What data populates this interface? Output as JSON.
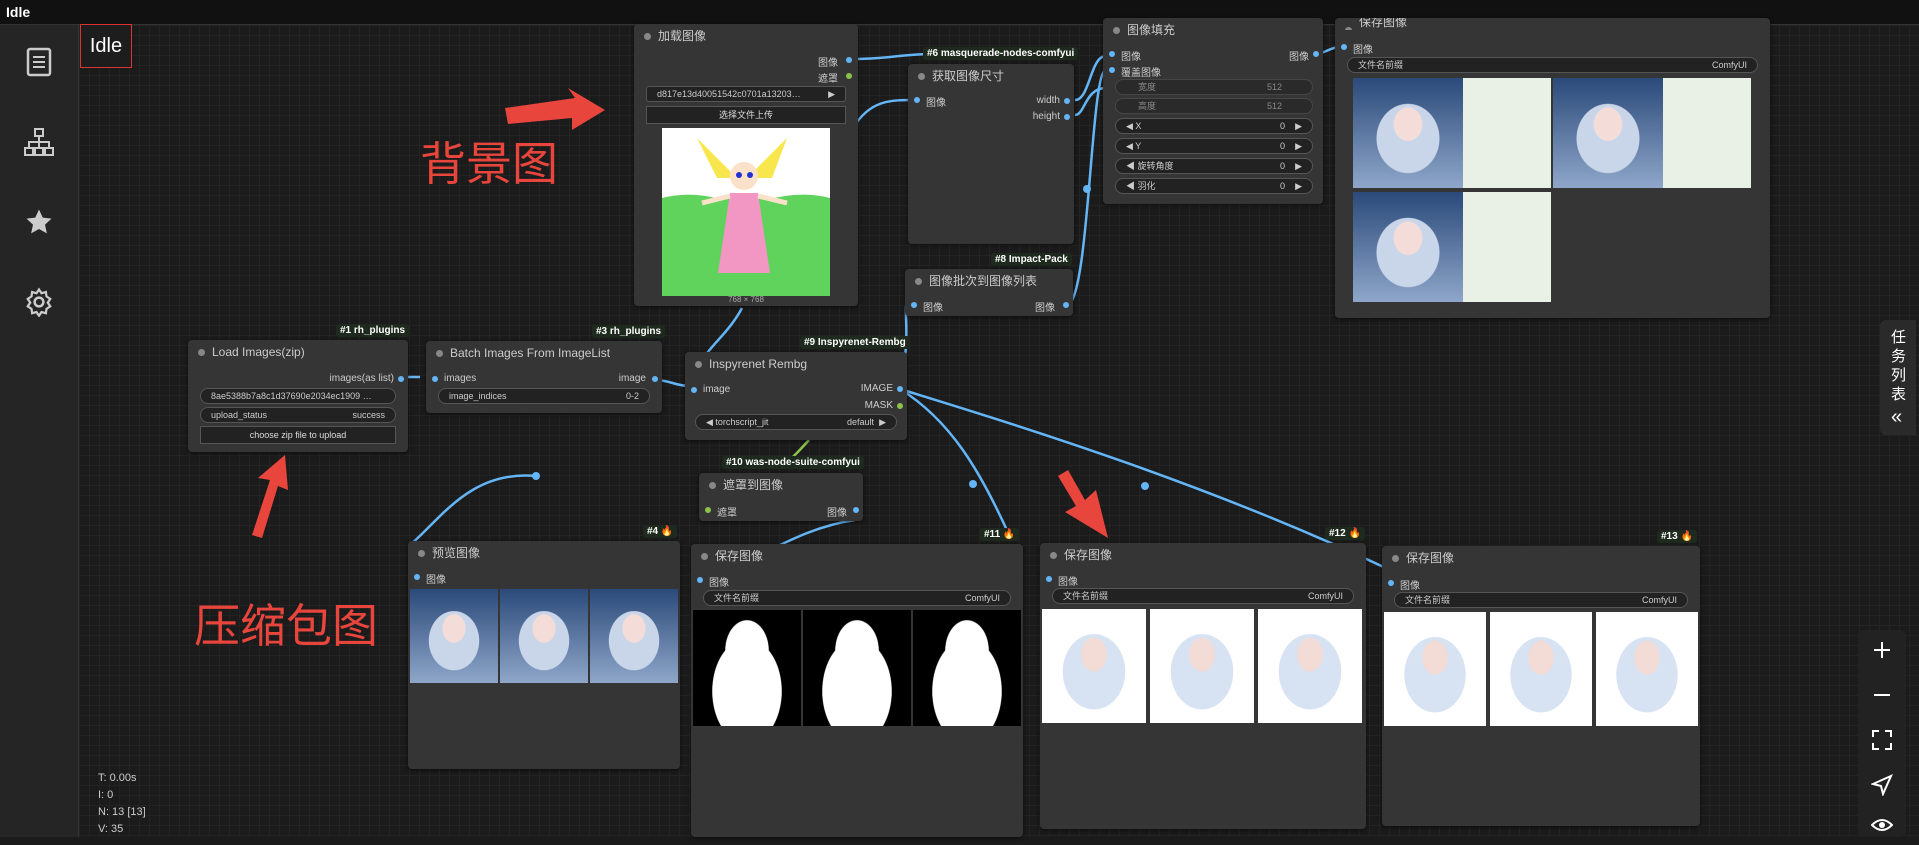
{
  "window_title": "Idle",
  "status_label": "Idle",
  "sidebar": {
    "icons": [
      "book-icon",
      "hierarchy-icon",
      "star-icon",
      "gear-icon"
    ]
  },
  "annotations": {
    "bg_label": "背景图",
    "zip_label": "压缩包图"
  },
  "stats": {
    "t": "T: 0.00s",
    "i": "I: 0",
    "n": "N: 13 [13]",
    "v": "V: 35"
  },
  "task_panel": {
    "label": "任务列表",
    "chevron": "«"
  },
  "nodes": {
    "load_image": {
      "title": "加载图像",
      "out_image": "图像",
      "out_mask": "遮罩",
      "file": "d817e13d40051542c0701a13203…",
      "upload_btn": "选择文件上传",
      "size": "768 × 768"
    },
    "masquerade": {
      "badge": "#6 masquerade-nodes-comfyui"
    },
    "get_size": {
      "title": "获取图像尺寸",
      "in_image": "图像",
      "out_width": "width",
      "out_height": "height"
    },
    "fill": {
      "title": "图像填充",
      "in_image": "图像",
      "in_overlay": "覆盖图像",
      "out_image": "图像",
      "w_label": "宽度",
      "w_val": "512",
      "h_label": "高度",
      "h_val": "512",
      "x_label": "X",
      "x_val": "0",
      "y_label": "Y",
      "y_val": "0",
      "rot_label": "旋转角度",
      "rot_val": "0",
      "feather_label": "羽化",
      "feather_val": "0"
    },
    "save_top": {
      "title": "保存图像",
      "in_image": "图像",
      "prefix_label": "文件名前缀",
      "prefix_val": "ComfyUI"
    },
    "impact": {
      "badge": "#8 Impact-Pack",
      "title": "图像批次到图像列表",
      "in_image": "图像",
      "out_image": "图像"
    },
    "load_zip": {
      "badge": "#1 rh_plugins",
      "title": "Load Images(zip)",
      "out": "images(as list)",
      "file": "8ae5388b7a8c1d37690e2034ec1909 …",
      "status_label": "upload_status",
      "status_val": "success",
      "btn": "choose zip file to upload"
    },
    "batch": {
      "badge": "#3 rh_plugins",
      "title": "Batch Images From ImageList",
      "in": "images",
      "out": "image",
      "idx_label": "image_indices",
      "idx_val": "0-2"
    },
    "rembg": {
      "badge": "#9 Inspyrenet-Rembg",
      "title": "Inspyrenet Rembg",
      "in": "image",
      "out_image": "IMAGE",
      "out_mask": "MASK",
      "opt_label": "torchscript_jit",
      "opt_val": "default"
    },
    "mask_to_image": {
      "badge": "#10 was-node-suite-comfyui",
      "title": "遮罩到图像",
      "in": "遮罩",
      "out": "图像"
    },
    "preview": {
      "badge": "#4 🔥",
      "title": "预览图像",
      "in": "图像"
    },
    "save11": {
      "badge": "#11 🔥",
      "title": "保存图像",
      "in": "图像",
      "prefix_label": "文件名前缀",
      "prefix_val": "ComfyUI"
    },
    "save12": {
      "badge": "#12 🔥",
      "title": "保存图像",
      "in": "图像",
      "prefix_label": "文件名前缀",
      "prefix_val": "ComfyUI"
    },
    "save13": {
      "badge": "#13 🔥",
      "title": "保存图像",
      "in": "图像",
      "prefix_label": "文件名前缀",
      "prefix_val": "ComfyUI"
    }
  },
  "zoom_controls": [
    "plus-icon",
    "minus-icon",
    "fit-view-icon",
    "navigate-icon",
    "eye-icon"
  ],
  "colors": {
    "link": "#64b5f6",
    "annotation": "#e8453c",
    "node_bg": "#353535"
  }
}
